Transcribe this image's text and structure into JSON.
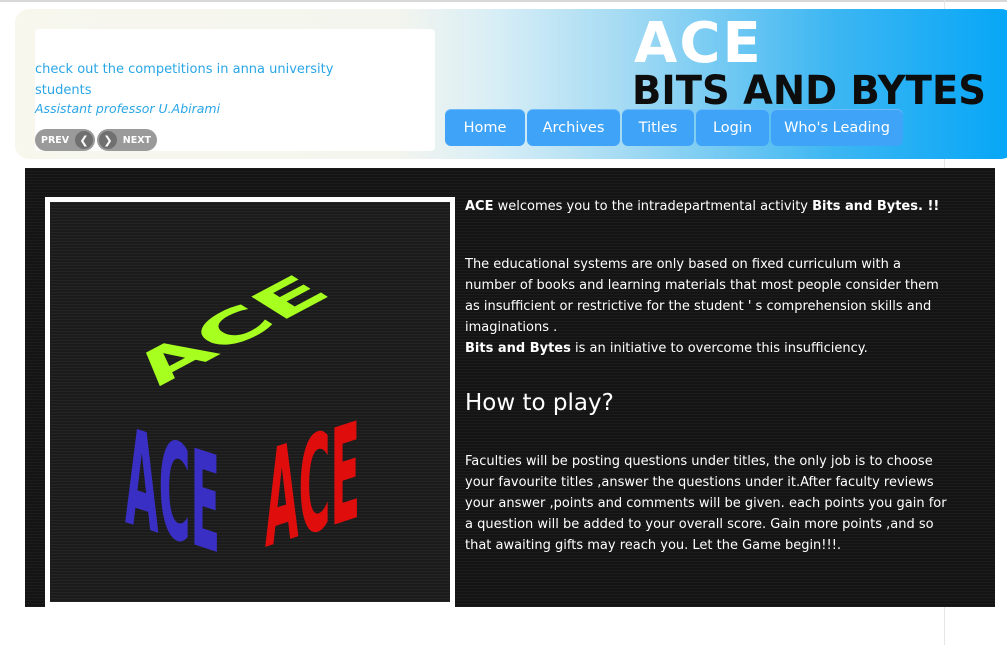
{
  "ticker": {
    "message": "check out the competitions in anna university students",
    "author": "Assistant professor U.Abirami",
    "prev_label": "PREV",
    "next_label": "NEXT"
  },
  "logo": {
    "line1": "ACE",
    "line2": "BITS AND BYTES"
  },
  "nav": {
    "items": [
      {
        "label": "Home"
      },
      {
        "label": "Archives"
      },
      {
        "label": "Titles"
      },
      {
        "label": "Login"
      },
      {
        "label": "Who's Leading"
      }
    ]
  },
  "cube": {
    "faces": [
      "ACE",
      "ACE",
      "ACE"
    ],
    "colors": {
      "top": "#a6ff1e",
      "left": "#3a2fc4",
      "right": "#e00d0d"
    }
  },
  "content": {
    "intro_bold_1": "ACE",
    "intro_mid": " welcomes you to the intradepartmental activity ",
    "intro_bold_2": "Bits and Bytes. !!",
    "body_1": "The educational systems are only based on fixed curriculum with a number of books and learning materials that most people consider them as insufficient or restrictive for the student ' s comprehension skills and imaginations .",
    "body_2_bold": "Bits and Bytes",
    "body_2_rest": " is an initiative to overcome this insufficiency.",
    "heading": "How to play?",
    "body_3": "Faculties will be posting questions under titles, the only job is to choose your favourite titles ,answer the questions under it.After faculty reviews your answer ,points and comments will be given. each points you gain for a question will be added to your overall score. Gain more points ,and so that awaiting gifts may reach you. Let the Game begin!!!."
  },
  "colors": {
    "link_blue": "#2aa6e6",
    "nav_blue": "#3fa3f8",
    "panel_dark": "#141414"
  }
}
